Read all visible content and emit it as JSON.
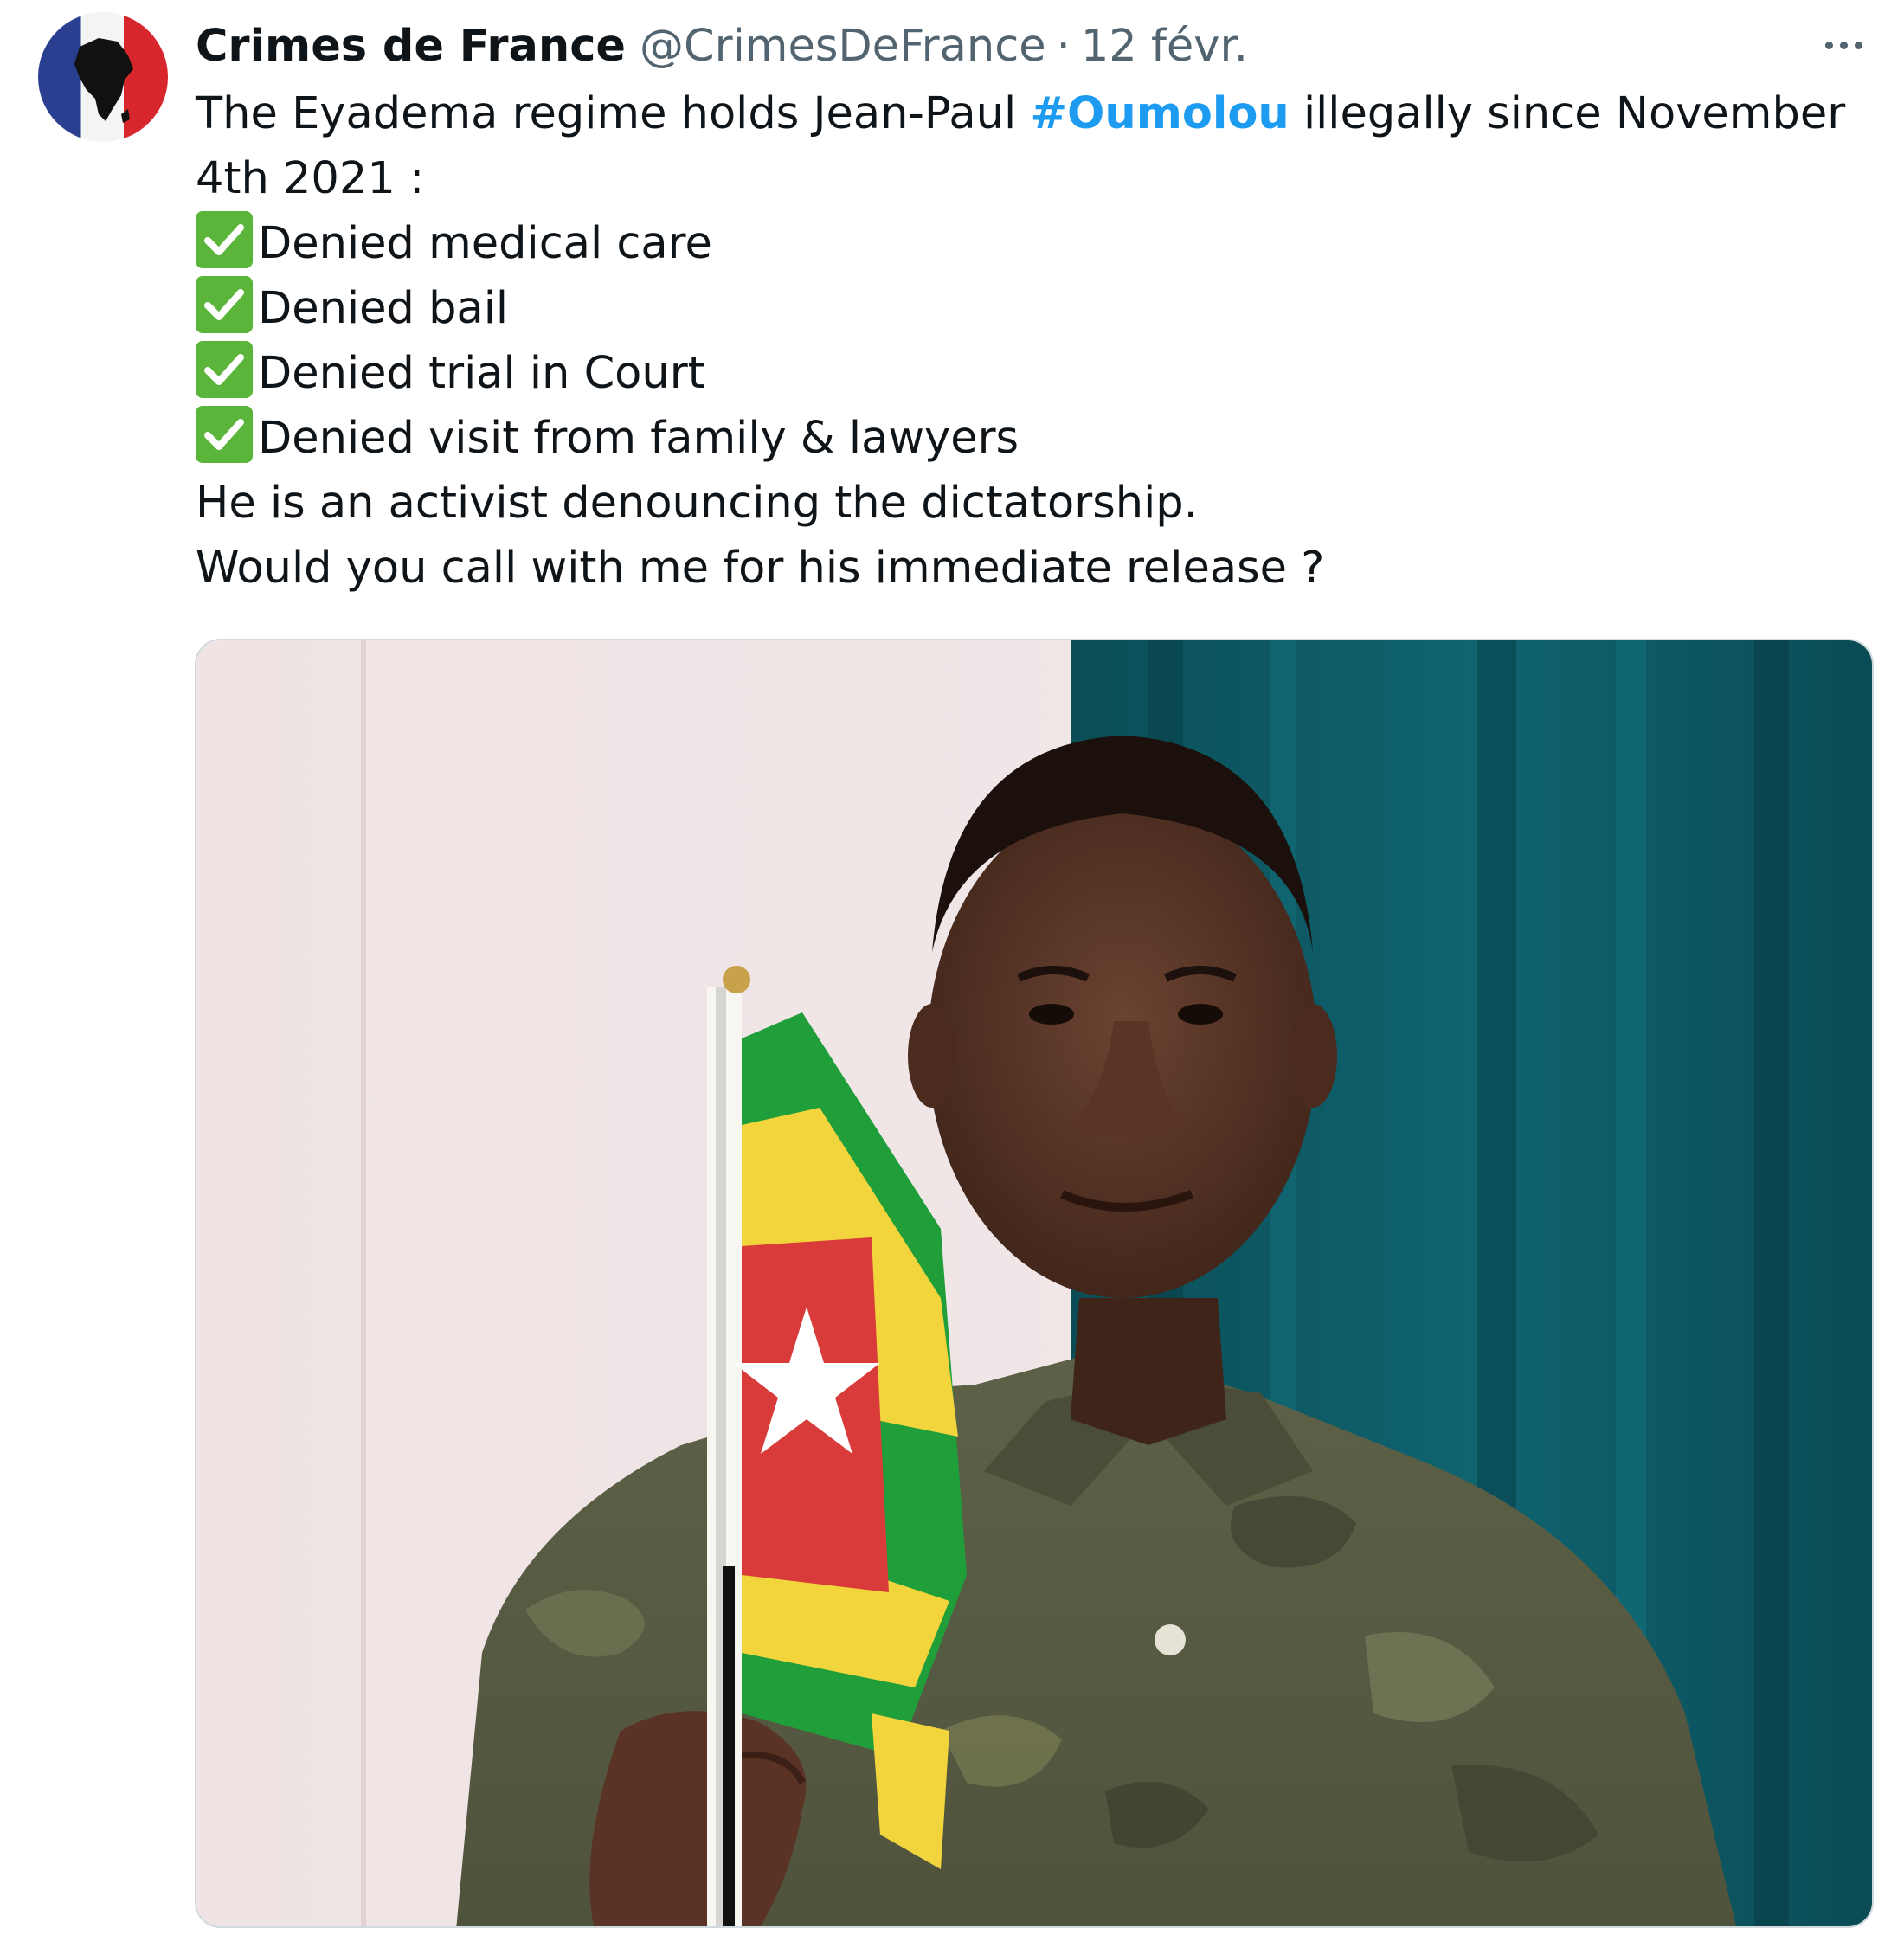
{
  "author": {
    "display_name": "Crimes de France",
    "handle": "@CrimesDeFrance",
    "separator": "·",
    "time": "12 févr."
  },
  "tweet": {
    "line1_before": "The Eyadema regime holds Jean-Paul ",
    "hashtag": "#Oumolou",
    "line1_after": " illegally since November",
    "line2": "4th 2021 :",
    "checks": [
      "Denied medical care",
      "Denied bail",
      "Denied trial in Court",
      "Denied visit from family & lawyers"
    ],
    "line_activist": "He is an activist denouncing the dictatorship.",
    "line_call": "Would you call with me for his immediate release ?"
  },
  "icons": {
    "more": "more-horizontal-icon",
    "check": "check-mark-button-emoji"
  },
  "colors": {
    "hashtag": "#1d9bf0",
    "secondary_text": "#536471",
    "check_green": "#5bb53a",
    "flag_green": "#1f9e3a",
    "flag_yellow": "#f2d53c",
    "flag_red": "#d93a3a"
  }
}
